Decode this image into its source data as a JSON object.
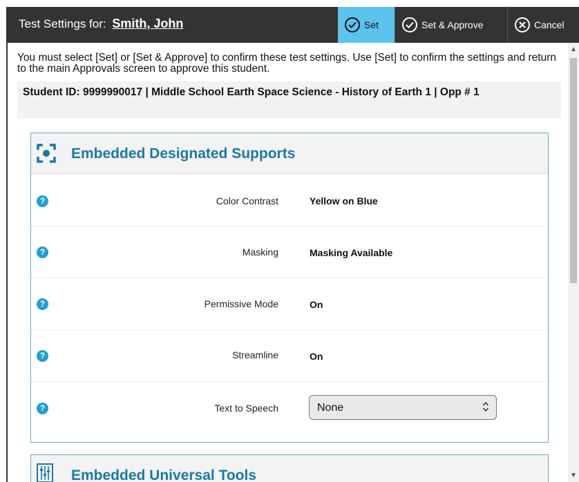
{
  "header": {
    "title_prefix": "Test Settings for:",
    "student_name": "Smith, John",
    "buttons": {
      "set": "Set",
      "set_approve": "Set & Approve",
      "cancel": "Cancel"
    }
  },
  "instructions": "You must select [Set] or [Set & Approve] to confirm these test settings. Use [Set] to confirm the settings and return to the main Approvals screen to approve this student.",
  "student_info": "Student ID: 9999990017 | Middle School Earth Space Science - History of Earth 1 | Opp # 1",
  "sections": [
    {
      "title": "Embedded Designated Supports",
      "icon": "focus-icon",
      "settings": [
        {
          "label": "Color Contrast",
          "value": "Yellow on Blue"
        },
        {
          "label": "Masking",
          "value": "Masking Available"
        },
        {
          "label": "Permissive Mode",
          "value": "On"
        },
        {
          "label": "Streamline",
          "value": "On"
        },
        {
          "label": "Text to Speech",
          "value": "None",
          "control": "select"
        }
      ]
    },
    {
      "title": "Embedded Universal Tools",
      "icon": "sliders-icon"
    }
  ],
  "help_glyph": "?",
  "colors": {
    "header_bg": "#333333",
    "set_button_bg": "#5cc3ed",
    "section_title": "#1a7aa0",
    "help_icon": "#1da0d0",
    "section_border": "#6fa7c4"
  }
}
